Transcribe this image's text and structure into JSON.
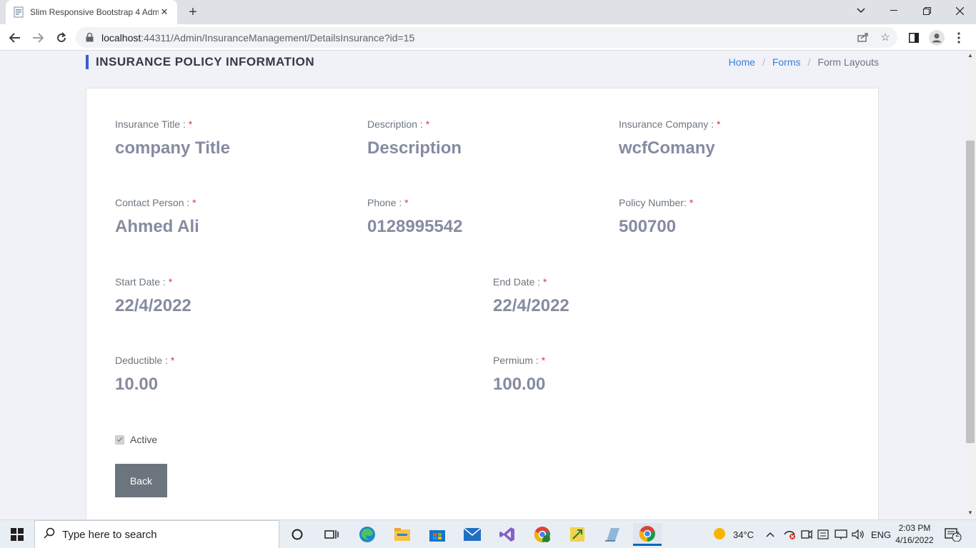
{
  "browser": {
    "tab_title": "Slim Responsive Bootstrap 4 Adm",
    "url_host": "localhost",
    "url_rest": ":44311/Admin/InsuranceManagement/DetailsInsurance?id=15"
  },
  "page": {
    "title": "INSURANCE POLICY INFORMATION",
    "breadcrumb": {
      "home": "Home",
      "forms": "Forms",
      "current": "Form Layouts",
      "separator": "/"
    }
  },
  "form": {
    "required_mark": "*",
    "insurance_title": {
      "label": "Insurance Title :",
      "value": "company Title"
    },
    "description": {
      "label": "Description :",
      "value": "Description"
    },
    "insurance_company": {
      "label": "Insurance Company :",
      "value": "wcfComany"
    },
    "contact_person": {
      "label": "Contact Person :",
      "value": "Ahmed Ali"
    },
    "phone": {
      "label": "Phone :",
      "value": "0128995542"
    },
    "policy_number": {
      "label": "Policy Number:",
      "value": "500700"
    },
    "start_date": {
      "label": "Start Date :",
      "value": "22/4/2022"
    },
    "end_date": {
      "label": "End Date :",
      "value": "22/4/2022"
    },
    "deductible": {
      "label": "Deductible :",
      "value": "10.00"
    },
    "permium": {
      "label": "Permium :",
      "value": "100.00"
    },
    "active": {
      "label": "Active",
      "checked": true
    },
    "back_label": "Back"
  },
  "taskbar": {
    "search_placeholder": "Type here to search",
    "weather": "34°C",
    "language": "ENG",
    "time": "2:03 PM",
    "date": "4/16/2022",
    "notification_count": "2"
  },
  "colors": {
    "accent": "#3b5cd9",
    "link": "#3b7ddd",
    "required": "#dc3545",
    "value_text": "#868ba1",
    "button": "#6c757d"
  }
}
